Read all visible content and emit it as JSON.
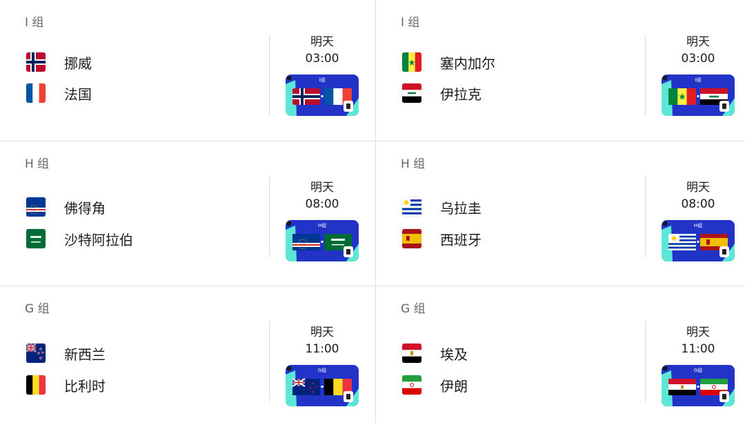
{
  "cards": [
    {
      "group": "I 组",
      "team1": {
        "name": "挪威",
        "flag": "norway-flag"
      },
      "team2": {
        "name": "法国",
        "flag": "france-flag"
      },
      "day": "明天",
      "time": "03:00",
      "thumb_label": "I组"
    },
    {
      "group": "I 组",
      "team1": {
        "name": "塞内加尔",
        "flag": "senegal-flag"
      },
      "team2": {
        "name": "伊拉克",
        "flag": "iraq-flag"
      },
      "day": "明天",
      "time": "03:00",
      "thumb_label": "I组"
    },
    {
      "group": "H 组",
      "team1": {
        "name": "佛得角",
        "flag": "cape-verde-flag"
      },
      "team2": {
        "name": "沙特阿拉伯",
        "flag": "saudi-arabia-flag"
      },
      "day": "明天",
      "time": "08:00",
      "thumb_label": "H组"
    },
    {
      "group": "H 组",
      "team1": {
        "name": "乌拉圭",
        "flag": "uruguay-flag"
      },
      "team2": {
        "name": "西班牙",
        "flag": "spain-flag"
      },
      "day": "明天",
      "time": "08:00",
      "thumb_label": "H组"
    },
    {
      "group": "G 组",
      "team1": {
        "name": "新西兰",
        "flag": "new-zealand-flag"
      },
      "team2": {
        "name": "比利时",
        "flag": "belgium-flag"
      },
      "day": "明天",
      "time": "11:00",
      "thumb_label": "G组"
    },
    {
      "group": "G 组",
      "team1": {
        "name": "埃及",
        "flag": "egypt-flag"
      },
      "team2": {
        "name": "伊朗",
        "flag": "iran-flag"
      },
      "day": "明天",
      "time": "11:00",
      "thumb_label": "G组"
    }
  ],
  "colors": {
    "thumb_bg": "#2234c8",
    "thumb_accent": "#5ce6d6",
    "divider": "#dcdcdc"
  }
}
